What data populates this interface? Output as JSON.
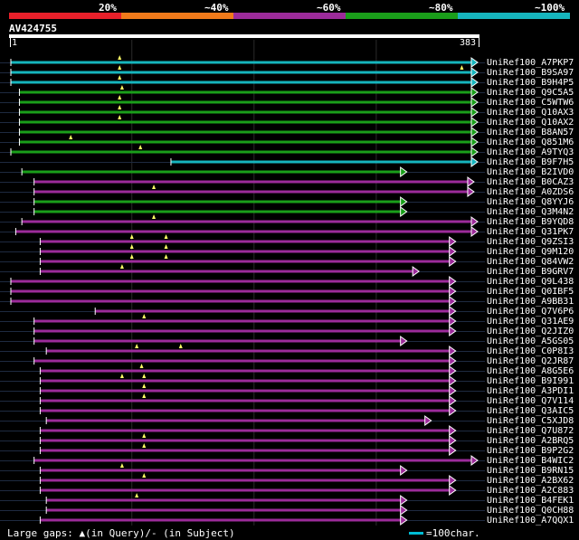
{
  "query": {
    "id": "AV424755",
    "start": "1",
    "end": "383",
    "length": 383
  },
  "legend": [
    {
      "label": "20%",
      "color": "#e8202a"
    },
    {
      "label": "~40%",
      "color": "#f07a1a"
    },
    {
      "label": "~60%",
      "color": "#9c2b9a"
    },
    {
      "label": "~80%",
      "color": "#1a9e1a"
    },
    {
      "label": "~100%",
      "color": "#16b5bd"
    }
  ],
  "footer": {
    "gaps_text": "Large gaps: ▲(in Query)/- (in Subject)",
    "scale_text": "=100char."
  },
  "hits": [
    {
      "name": "UniRef100_A7PKP7",
      "start": 1,
      "end": 383,
      "color": "cyan",
      "markers": [
        90
      ],
      "gaps": []
    },
    {
      "name": "UniRef100_B9SA97",
      "start": 1,
      "end": 383,
      "color": "cyan",
      "markers": [
        90,
        370
      ],
      "gaps": []
    },
    {
      "name": "UniRef100_B9H4P5",
      "start": 1,
      "end": 383,
      "color": "cyan",
      "markers": [
        90
      ],
      "gaps": []
    },
    {
      "name": "UniRef100_Q9C5A5",
      "start": 8,
      "end": 383,
      "color": "green",
      "markers": [
        92
      ],
      "gaps": []
    },
    {
      "name": "UniRef100_C5WTW6",
      "start": 8,
      "end": 383,
      "color": "green",
      "markers": [
        90
      ],
      "gaps": []
    },
    {
      "name": "UniRef100_Q10AX3",
      "start": 8,
      "end": 383,
      "color": "green",
      "markers": [
        90
      ],
      "gaps": []
    },
    {
      "name": "UniRef100_Q10AX2",
      "start": 8,
      "end": 383,
      "color": "green",
      "markers": [
        90
      ],
      "gaps": []
    },
    {
      "name": "UniRef100_B8AN57",
      "start": 8,
      "end": 383,
      "color": "green",
      "markers": [],
      "gaps": []
    },
    {
      "name": "UniRef100_Q851M6",
      "start": 8,
      "end": 383,
      "color": "green",
      "markers": [
        50
      ],
      "gaps": []
    },
    {
      "name": "UniRef100_A9TYQ3",
      "start": 1,
      "end": 383,
      "color": "green",
      "markers": [
        107
      ],
      "gaps": []
    },
    {
      "name": "UniRef100_B9F7H5",
      "start": 132,
      "end": 383,
      "color": "cyan",
      "markers": [],
      "gaps": []
    },
    {
      "name": "UniRef100_B2IVD0",
      "start": 10,
      "end": 325,
      "color": "green",
      "markers": [],
      "gaps": []
    },
    {
      "name": "UniRef100_B0CAZ3",
      "start": 20,
      "end": 380,
      "color": "purple",
      "markers": [],
      "gaps": []
    },
    {
      "name": "UniRef100_A0ZDS6",
      "start": 20,
      "end": 380,
      "color": "purple",
      "markers": [
        118
      ],
      "gaps": []
    },
    {
      "name": "UniRef100_Q8YYJ6",
      "start": 20,
      "end": 325,
      "color": "green",
      "markers": [],
      "gaps": []
    },
    {
      "name": "UniRef100_Q3M4N2",
      "start": 20,
      "end": 325,
      "color": "green",
      "markers": [],
      "gaps": []
    },
    {
      "name": "UniRef100_B9YQD8",
      "start": 10,
      "end": 383,
      "color": "purple",
      "markers": [
        118
      ],
      "gaps": []
    },
    {
      "name": "UniRef100_Q31PK7",
      "start": 5,
      "end": 383,
      "color": "purple",
      "markers": [],
      "gaps": []
    },
    {
      "name": "UniRef100_Q9ZSI3",
      "start": 25,
      "end": 365,
      "color": "purple",
      "markers": [
        100,
        128
      ],
      "gaps": []
    },
    {
      "name": "UniRef100_Q9M120",
      "start": 25,
      "end": 365,
      "color": "purple",
      "markers": [
        100,
        128
      ],
      "gaps": []
    },
    {
      "name": "UniRef100_Q84VW2",
      "start": 25,
      "end": 365,
      "color": "purple",
      "markers": [
        100,
        128
      ],
      "gaps": []
    },
    {
      "name": "UniRef100_B9GRV7",
      "start": 25,
      "end": 335,
      "color": "purple",
      "markers": [
        92
      ],
      "gaps": []
    },
    {
      "name": "UniRef100_Q9L438",
      "start": 1,
      "end": 365,
      "color": "purple",
      "markers": [],
      "gaps": []
    },
    {
      "name": "UniRef100_Q0IBF5",
      "start": 1,
      "end": 365,
      "color": "purple",
      "markers": [],
      "gaps": []
    },
    {
      "name": "UniRef100_A9BB31",
      "start": 1,
      "end": 365,
      "color": "purple",
      "markers": [],
      "gaps": []
    },
    {
      "name": "UniRef100_Q7V6P6",
      "start": 70,
      "end": 365,
      "color": "purple",
      "markers": [],
      "gaps": []
    },
    {
      "name": "UniRef100_Q31AE9",
      "start": 20,
      "end": 365,
      "color": "purple",
      "markers": [
        110
      ],
      "gaps": []
    },
    {
      "name": "UniRef100_Q2JIZ0",
      "start": 20,
      "end": 365,
      "color": "purple",
      "markers": [],
      "gaps": []
    },
    {
      "name": "UniRef100_A5GS05",
      "start": 20,
      "end": 325,
      "color": "purple",
      "markers": [],
      "gaps": []
    },
    {
      "name": "UniRef100_C0P8I3",
      "start": 30,
      "end": 365,
      "color": "purple",
      "markers": [
        104,
        140
      ],
      "gaps": []
    },
    {
      "name": "UniRef100_Q2JR87",
      "start": 20,
      "end": 365,
      "color": "purple",
      "markers": [],
      "gaps": []
    },
    {
      "name": "UniRef100_A8G5E6",
      "start": 25,
      "end": 365,
      "color": "purple",
      "markers": [
        108
      ],
      "gaps": []
    },
    {
      "name": "UniRef100_B9I991",
      "start": 25,
      "end": 365,
      "color": "purple",
      "markers": [
        92,
        110
      ],
      "gaps": []
    },
    {
      "name": "UniRef100_A3PDI1",
      "start": 25,
      "end": 365,
      "color": "purple",
      "markers": [
        110
      ],
      "gaps": []
    },
    {
      "name": "UniRef100_Q7V114",
      "start": 25,
      "end": 365,
      "color": "purple",
      "markers": [
        110
      ],
      "gaps": []
    },
    {
      "name": "UniRef100_Q3AIC5",
      "start": 25,
      "end": 365,
      "color": "purple",
      "markers": [],
      "gaps": []
    },
    {
      "name": "UniRef100_C5XJD8",
      "start": 30,
      "end": 345,
      "color": "purple",
      "markers": [],
      "gaps": []
    },
    {
      "name": "UniRef100_Q7U872",
      "start": 25,
      "end": 365,
      "color": "purple",
      "markers": [],
      "gaps": []
    },
    {
      "name": "UniRef100_A2BRQ5",
      "start": 25,
      "end": 365,
      "color": "purple",
      "markers": [
        110
      ],
      "gaps": []
    },
    {
      "name": "UniRef100_B9P2G2",
      "start": 25,
      "end": 365,
      "color": "purple",
      "markers": [
        110
      ],
      "gaps": []
    },
    {
      "name": "UniRef100_B4WIC2",
      "start": 20,
      "end": 383,
      "color": "purple",
      "markers": [],
      "gaps": []
    },
    {
      "name": "UniRef100_B9RN15",
      "start": 25,
      "end": 325,
      "color": "purple",
      "markers": [
        92
      ],
      "gaps": []
    },
    {
      "name": "UniRef100_A2BX62",
      "start": 25,
      "end": 365,
      "color": "purple",
      "markers": [
        110
      ],
      "gaps": []
    },
    {
      "name": "UniRef100_A2C883",
      "start": 25,
      "end": 365,
      "color": "purple",
      "markers": [],
      "gaps": []
    },
    {
      "name": "UniRef100_B4FEK1",
      "start": 30,
      "end": 325,
      "color": "purple",
      "markers": [
        104
      ],
      "gaps": []
    },
    {
      "name": "UniRef100_Q0CH88",
      "start": 30,
      "end": 325,
      "color": "purple",
      "markers": [],
      "gaps": []
    },
    {
      "name": "UniRef100_A7QQX1",
      "start": 25,
      "end": 325,
      "color": "purple",
      "markers": [],
      "gaps": []
    }
  ],
  "colors": {
    "cyan": "#16b5bd",
    "green": "#1a9e1a",
    "purple": "#9c2b9a",
    "grid": "#1e2a40",
    "bg": "#000000"
  }
}
